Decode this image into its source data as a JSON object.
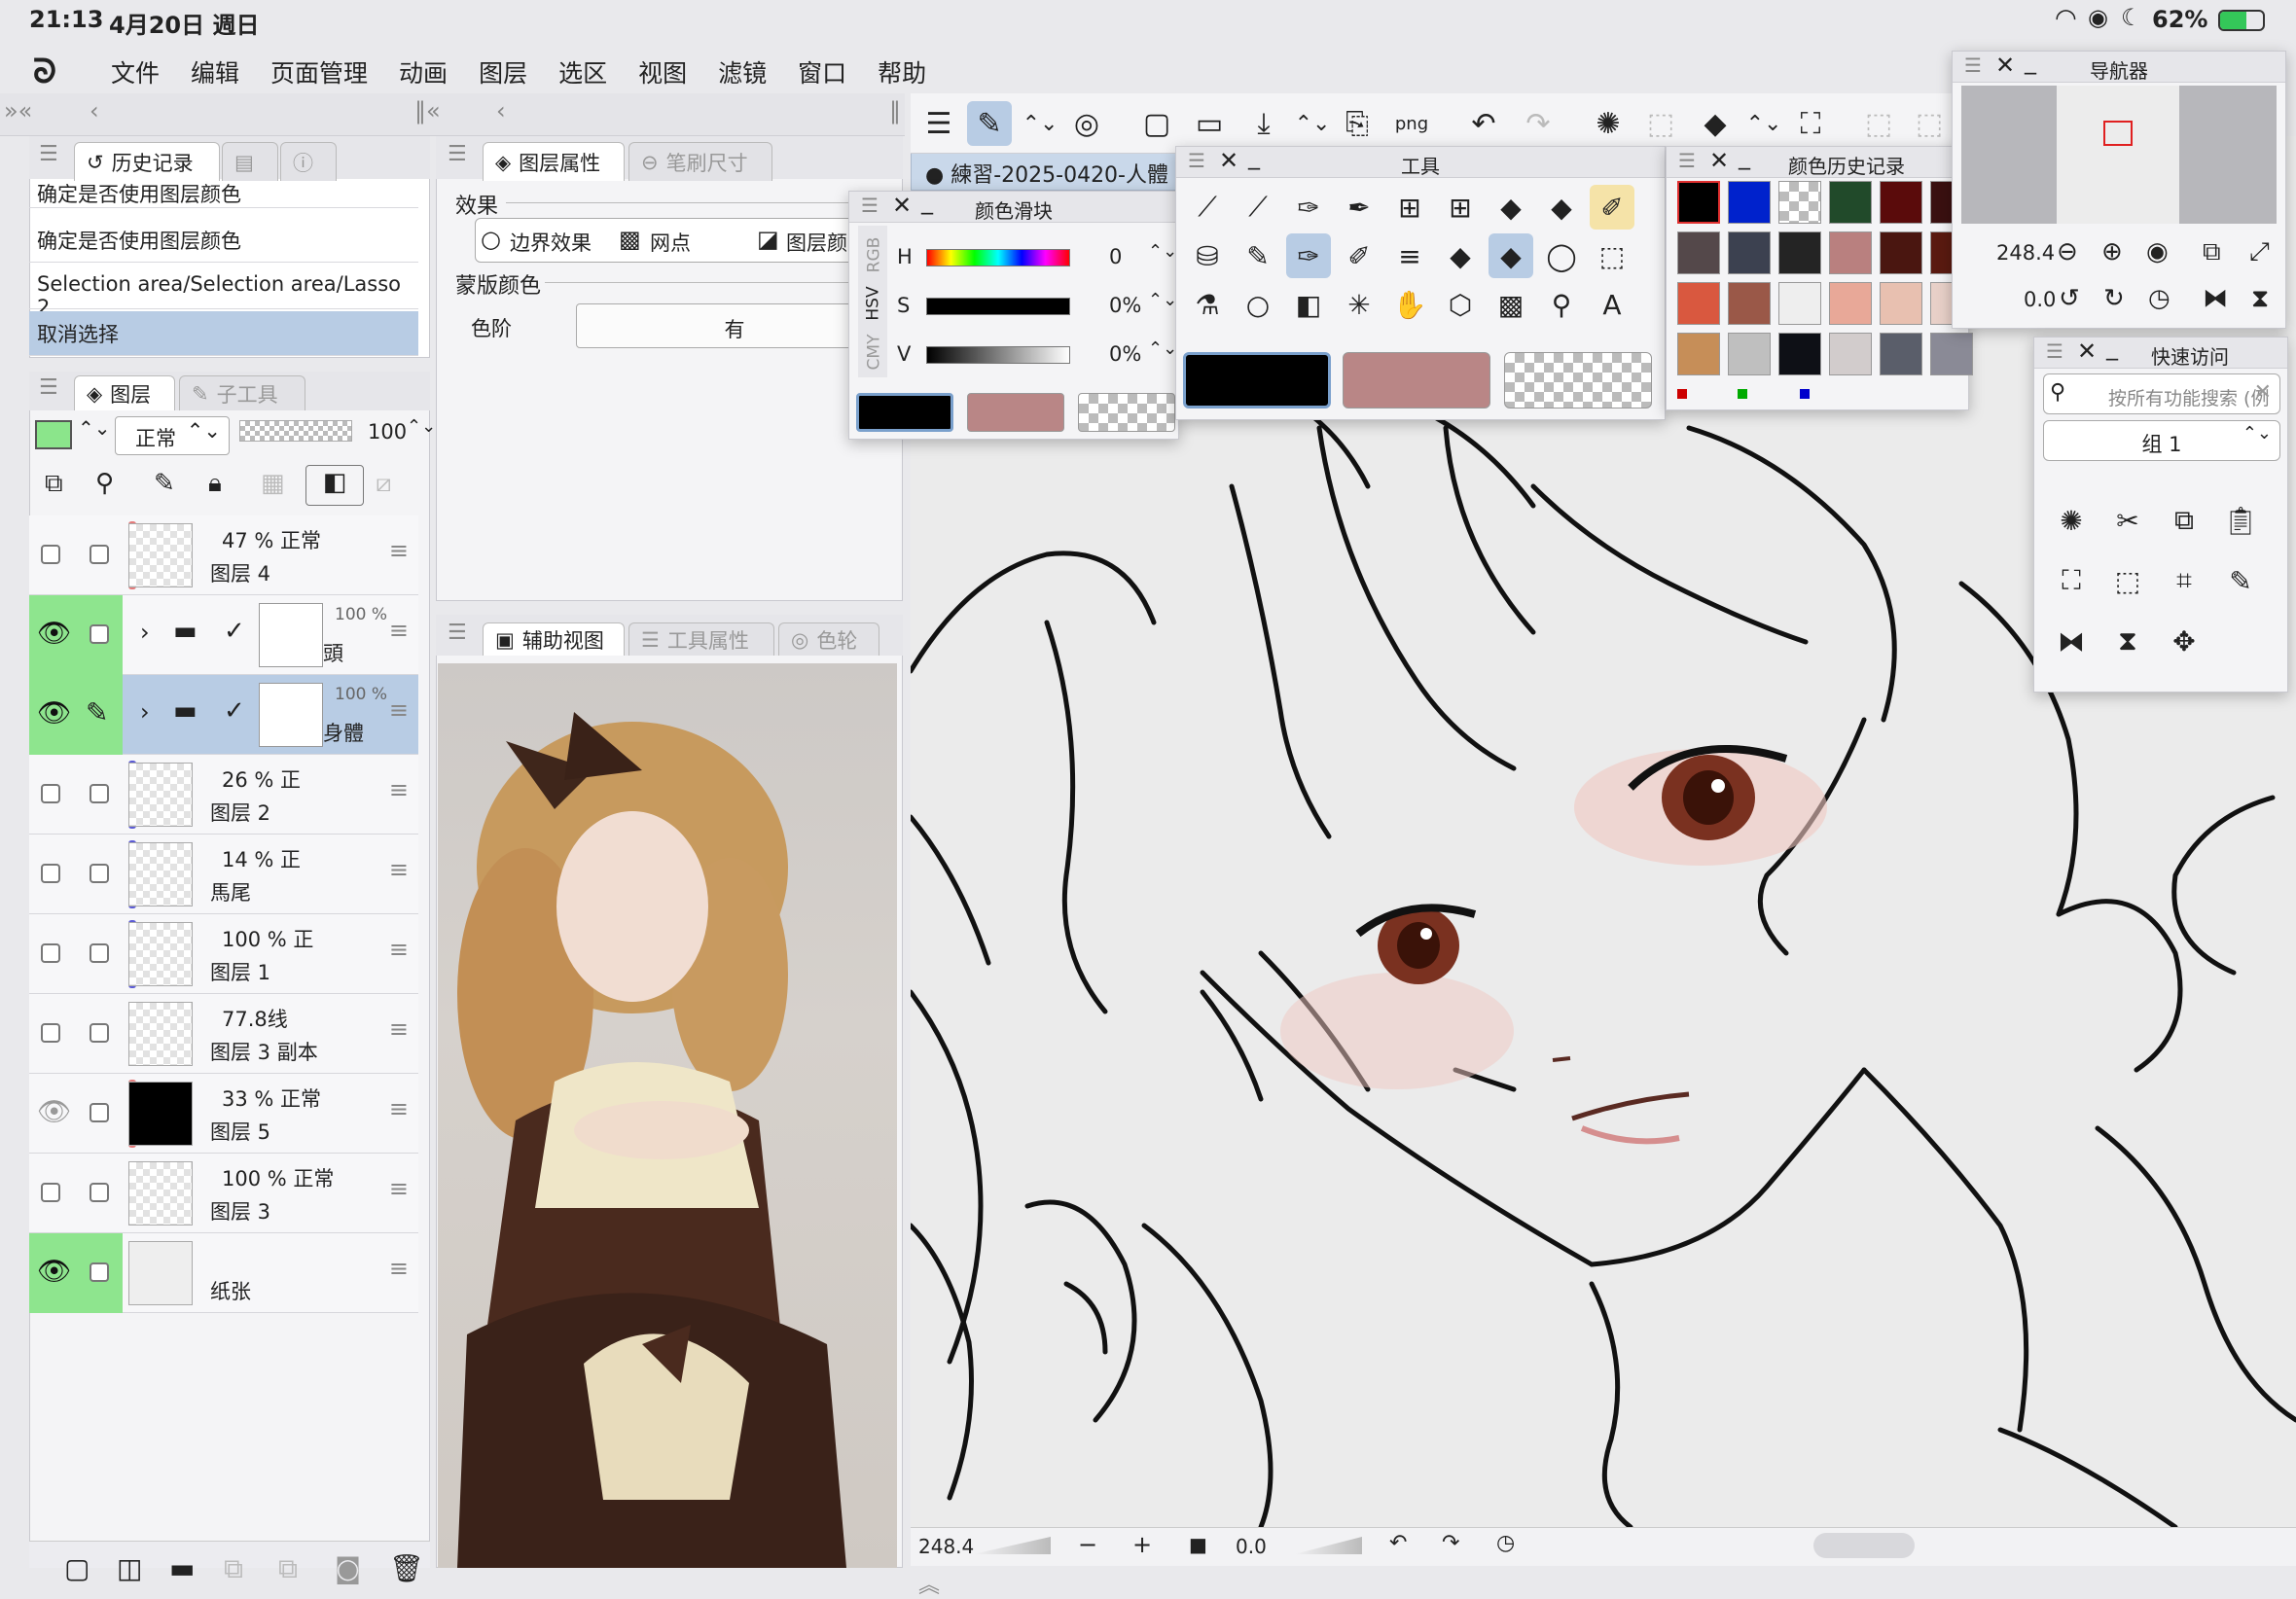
{
  "status_bar": {
    "time": "21:13",
    "date": "4月20日 週日",
    "battery": "62%"
  },
  "menu": {
    "items": [
      "文件",
      "编辑",
      "页面管理",
      "动画",
      "图层",
      "选区",
      "视图",
      "滤镜",
      "窗口",
      "帮助"
    ]
  },
  "history_panel": {
    "tabs": [
      "历史记录"
    ],
    "items": [
      "确定是否使用图层颜色",
      "确定是否使用图层颜色",
      "Selection area/Selection area/Lasso 2",
      "取消选择"
    ]
  },
  "layer_props_panel": {
    "tabs": [
      "图层属性",
      "笔刷尺寸"
    ],
    "effect_label": "效果",
    "effects": [
      "边界效果",
      "网点",
      "图层颜"
    ],
    "mask_label": "蒙版颜色",
    "level_label": "色阶",
    "level_value": "有"
  },
  "layers_panel": {
    "tabs": [
      "图层",
      "子工具"
    ],
    "blend_mode": "正常",
    "opacity": "100",
    "layers": [
      {
        "mode": "47 % 正常",
        "name": "图层 4",
        "bar": "#e57b7b"
      },
      {
        "mode": "100 %",
        "name": "頭",
        "bar": ""
      },
      {
        "mode": "100 %",
        "name": "身體",
        "bar": ""
      },
      {
        "mode": "26 % 正",
        "name": "图层 2",
        "bar": "#5b5bd6"
      },
      {
        "mode": "14 % 正",
        "name": "馬尾",
        "bar": "#5b5bd6"
      },
      {
        "mode": "100 % 正",
        "name": "图层 1",
        "bar": "#5b5bd6"
      },
      {
        "mode": "77.8线",
        "name": "图层 3 副本",
        "bar": ""
      },
      {
        "mode": "33 % 正常",
        "name": "图层 5",
        "bar": "#e57b7b"
      },
      {
        "mode": "100 % 正常",
        "name": "图层 3",
        "bar": ""
      },
      {
        "mode": "",
        "name": "纸张",
        "bar": ""
      }
    ]
  },
  "sub_view_panel": {
    "tabs": [
      "辅助视图",
      "工具属性",
      "色轮"
    ]
  },
  "color_slider": {
    "title": "颜色滑块",
    "side_tabs": [
      "RGB",
      "HSV",
      "CMY"
    ],
    "rows": [
      {
        "label": "H",
        "value": "0"
      },
      {
        "label": "S",
        "value": "0%"
      },
      {
        "label": "V",
        "value": "0%"
      }
    ]
  },
  "tool_panel": {
    "title": "工具"
  },
  "color_history": {
    "title": "颜色历史记录"
  },
  "navigator": {
    "title": "导航器",
    "zoom": "248.4",
    "rotate": "0.0"
  },
  "quick_access": {
    "title": "快速访问",
    "search_placeholder": "按所有功能搜索 (例",
    "group": "组 1"
  },
  "canvas": {
    "tab_title": "練習-2025-0420-人體",
    "zoom": "248.4",
    "angle": "0.0"
  },
  "colors": {
    "main": "#000000",
    "sub": "#b98686",
    "swatches": [
      "#000000",
      "#0022cc",
      "#checker",
      "#214a2a",
      "#5a0b0b",
      "#3a1010",
      "#54484a",
      "#3c4150",
      "#242424",
      "#b9807f",
      "#4a1610",
      "#5a1a10",
      "#d9583f",
      "#9a5848",
      "#eeeeee",
      "#e8a898",
      "#e8c0b0",
      "#e8d0c8",
      "#c68e58",
      "#bfbfbf",
      "#0e1016",
      "#d2cccc",
      "#5a5e6a",
      "#8a8a96"
    ]
  }
}
